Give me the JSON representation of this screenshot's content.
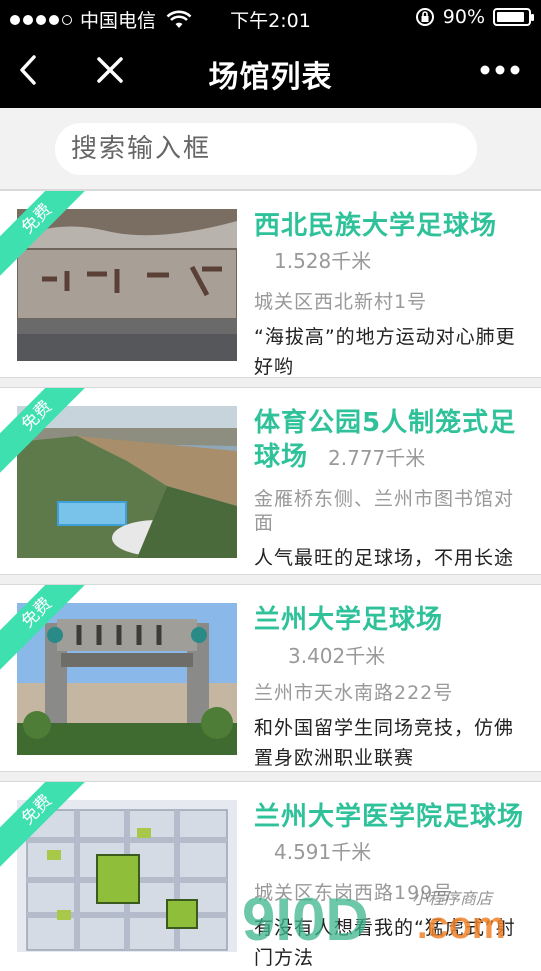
{
  "status_bar": {
    "carrier": "中国电信",
    "time": "下午2:01",
    "battery": "90%",
    "battery_level": 0.9
  },
  "nav": {
    "title": "场馆列表",
    "back_icon": "chevron-left-icon",
    "close_icon": "close-icon",
    "more_icon": "more-icon"
  },
  "search": {
    "placeholder": "搜索输入框"
  },
  "badge_label": "免费",
  "venues": [
    {
      "name": "西北民族大学足球场",
      "distance": "1.528千米",
      "address": "城关区西北新村1号",
      "description": "“海拔高”的地方运动对心肺更好哟"
    },
    {
      "name": "体育公园5人制笼式足球场",
      "distance": "2.777千米",
      "address": "金雁桥东侧、兰州市图书馆对面",
      "description": "人气最旺的足球场，不用长途奔袭也能体验射门快感"
    },
    {
      "name": "兰州大学足球场",
      "distance": "3.402千米",
      "address": "兰州市天水南路222号",
      "description": "和外国留学生同场竞技，仿佛置身欧洲职业联赛"
    },
    {
      "name": "兰州大学医学院足球场",
      "distance": "4.591千米",
      "address": "城关区东岗西路199号",
      "description": "有没有人想看我的“猛虎式”射门方法"
    }
  ],
  "watermark": {
    "brand": "9I0D",
    "suffix": ".com",
    "tag": "小程序商店"
  }
}
